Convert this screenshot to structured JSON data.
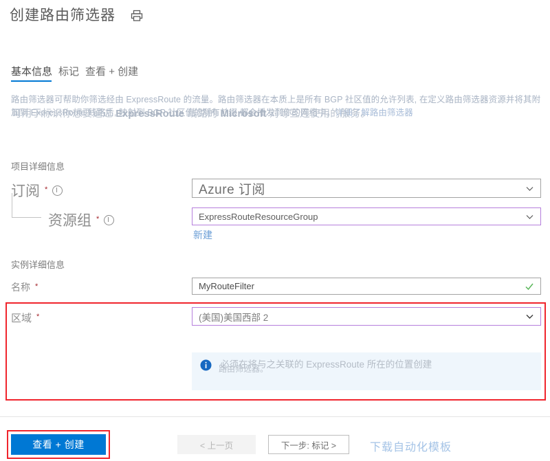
{
  "header": {
    "title": "创建路由筛选器",
    "print_icon": "printer-icon"
  },
  "tabs": [
    {
      "label": "基本信息",
      "active": true
    },
    {
      "label": "标记",
      "active": false
    },
    {
      "label": "查看 + 创建",
      "active": false
    }
  ],
  "description": {
    "line_a": "路由筛选器可帮助你筛选经由 ExpressRoute 的流量。路由筛选器在本质上是所有 BGP 社区值的允许列表,",
    "line_b_part1": "可用于标识你想要通过 ",
    "line_b_bold1": "ExpressRoute",
    "line_b_part2": " 线路的 ",
    "line_b_bold2": "Microsoft",
    "line_b_part3": " 对等互连使用的服务。",
    "line_c": "在定义路由筛选器资源并将其附加到 ExpressRoute 线路后, 映射到 BGP 社区值的所有前缀",
    "line_d": "都会播发到你的网络中。",
    "link": "详细了解路由筛选器"
  },
  "project_details": {
    "title": "项目详细信息",
    "subscription": {
      "label": "订阅",
      "required": "*",
      "info_icon": "info-icon",
      "value": "Azure 订阅",
      "chevron": "chevron-down-icon"
    },
    "resource_group": {
      "label": "资源组",
      "required": "*",
      "info_icon": "info-icon",
      "value": "ExpressRouteResourceGroup",
      "chevron": "chevron-down-icon",
      "create_new": "新建"
    }
  },
  "instance_details": {
    "title": "实例详细信息",
    "name": {
      "label": "名称",
      "required": "*",
      "value": "MyRouteFilter",
      "valid_icon": "checkmark-icon"
    },
    "region": {
      "label": "区域",
      "required": "*",
      "value": "(美国)美国西部 2",
      "chevron": "chevron-down-icon"
    }
  },
  "info_banner": {
    "icon": "info-filled-icon",
    "text_a": "必须在将与之关联的 ExpressRoute 所在的位置创建",
    "text_b": "路由筛选器。"
  },
  "footer": {
    "review_create": "查看 + 创建",
    "previous": "< 上一页",
    "next": "下一步: 标记 >",
    "download_template": "下载自动化模板"
  },
  "colors": {
    "accent": "#0078d4",
    "highlight_red": "#f0242c",
    "required_star": "#a4262c",
    "purple_border": "#b57edc",
    "info_bg": "#eff6fc",
    "valid_green": "#5bb75b"
  }
}
